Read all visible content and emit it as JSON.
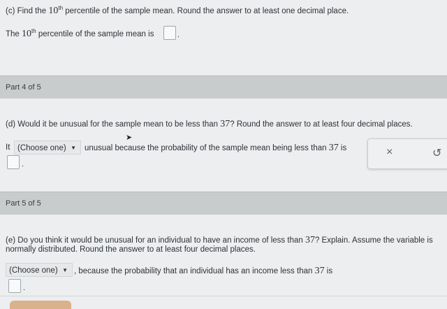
{
  "part_c": {
    "question": "(c) Find the 10th percentile of the sample mean. Round the answer to at least one decimal place.",
    "q_prefix": "(c) Find the ",
    "q_num": "10",
    "q_sup": "th",
    "q_suffix": " percentile of the sample mean. Round the answer to at least one decimal place.",
    "answer_prefix": "The ",
    "answer_num": "10",
    "answer_sup": "th",
    "answer_suffix": " percentile of the sample mean is",
    "answer_end": "."
  },
  "part4": {
    "label": "Part 4 of 5",
    "q_prefix": "(d) Would it be unusual for the sample mean to be less than ",
    "q_num": "37",
    "q_suffix": "? Round the answer to at least four decimal places.",
    "lead": "It",
    "select_value": "(Choose one)",
    "mid": "unusual because the probability of the sample mean being less than ",
    "mid_num": "37",
    "mid_end": " is",
    "answer_end": "."
  },
  "toolbar": {
    "clear_label": "×",
    "undo_label": "↺"
  },
  "part5": {
    "label": "Part 5 of 5",
    "q_line1_prefix": "(e) Do you think it would be unusual for an individual to have an income of less than ",
    "q_line1_num": "37",
    "q_line1_suffix": "? Explain. Assume the variable is",
    "q_line2": "normally distributed. Round the answer to at least four decimal places.",
    "select_value": "(Choose one)",
    "after_select_prefix": ", because the probability that an individual has an income less than ",
    "after_select_num": "37",
    "after_select_suffix": " is",
    "answer_end": "."
  },
  "icons": {
    "caret": "caret-down-icon",
    "clear": "x-icon",
    "undo": "undo-icon"
  }
}
